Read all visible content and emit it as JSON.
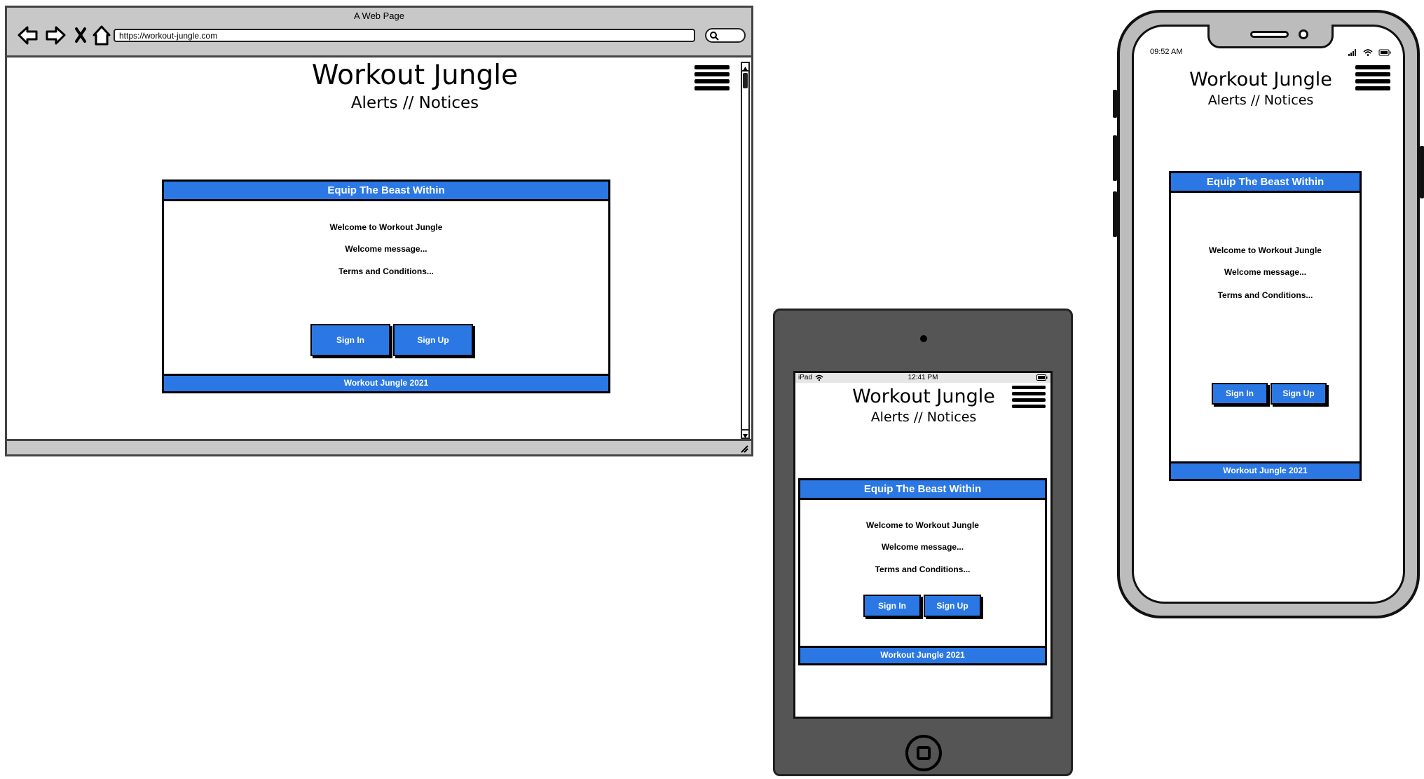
{
  "app": {
    "title": "Workout Jungle",
    "subtitle": "Alerts // Notices",
    "card_header": "Equip The Beast Within",
    "welcome_line": "Welcome to Workout Jungle",
    "message_line": "Welcome message...",
    "terms_line": "Terms and Conditions...",
    "sign_in_label": "Sign In",
    "sign_up_label": "Sign Up",
    "footer": "Workout Jungle 2021"
  },
  "browser": {
    "window_title": "A Web Page",
    "url": "https://workout-jungle.com",
    "nav_icons": [
      "back-arrow-icon",
      "forward-arrow-icon",
      "close-icon",
      "home-icon"
    ]
  },
  "tablet": {
    "device_label": "iPad",
    "time": "12:41 PM"
  },
  "phone": {
    "time": "09:52 AM"
  },
  "colors": {
    "accent": "#2b78e4",
    "frame_gray": "#c8c8c8",
    "tablet_body": "#555555"
  }
}
